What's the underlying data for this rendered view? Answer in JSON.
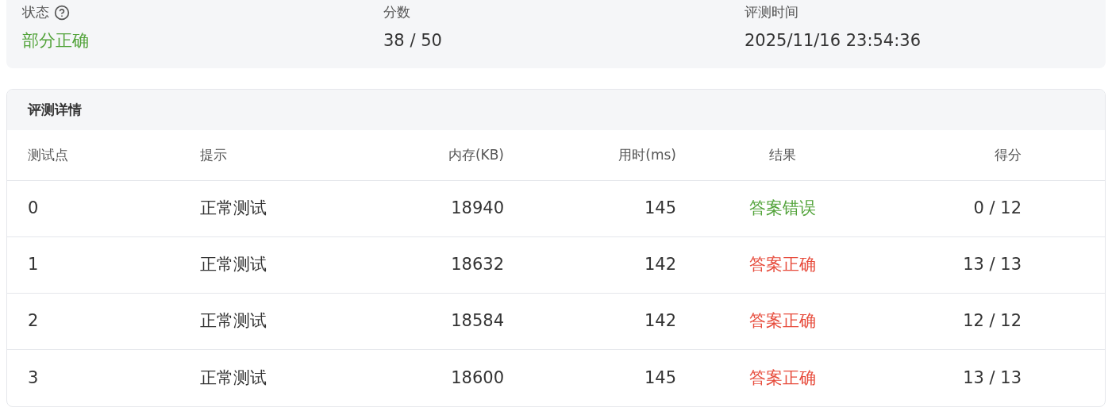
{
  "summary": [
    {
      "label": "状态",
      "help": true,
      "value": "部分正确",
      "color": "#52a33a"
    },
    {
      "label": "分数",
      "help": false,
      "value": "38 / 50",
      "color": "#333333"
    },
    {
      "label": "评测时间",
      "help": false,
      "value": "2025/11/16 23:54:36",
      "color": "#333333"
    }
  ],
  "details": {
    "title": "评测详情",
    "columns": [
      "测试点",
      "提示",
      "内存(KB)",
      "用时(ms)",
      "结果",
      "得分"
    ],
    "rows": [
      {
        "case": "0",
        "hint": "正常测试",
        "memory": "18940",
        "time": "145",
        "result": "答案错误",
        "color": "#52a33a",
        "score": "0 / 12"
      },
      {
        "case": "1",
        "hint": "正常测试",
        "memory": "18632",
        "time": "142",
        "result": "答案正确",
        "color": "#e74c3c",
        "score": "13 / 13"
      },
      {
        "case": "2",
        "hint": "正常测试",
        "memory": "18584",
        "time": "142",
        "result": "答案正确",
        "color": "#e74c3c",
        "score": "12 / 12"
      },
      {
        "case": "3",
        "hint": "正常测试",
        "memory": "18600",
        "time": "145",
        "result": "答案正确",
        "color": "#e74c3c",
        "score": "13 / 13"
      }
    ]
  }
}
